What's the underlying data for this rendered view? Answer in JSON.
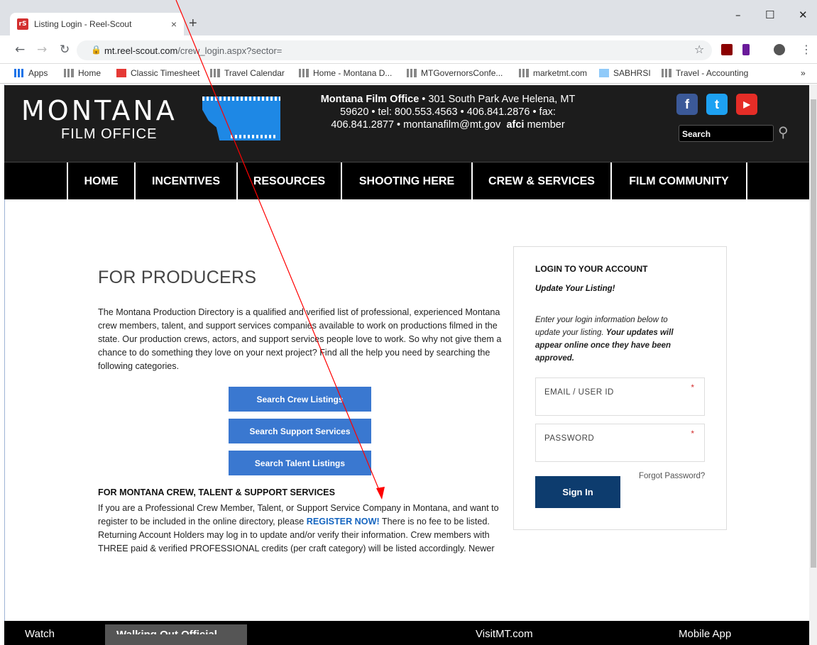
{
  "browser": {
    "tab_title": "Listing Login - Reel-Scout",
    "favicon_text": "rS",
    "tab_close": "×",
    "new_tab": "+",
    "url_domain": "mt.reel-scout.com",
    "url_path": "/crew_login.aspx?sector=",
    "win_min": "–",
    "win_max": "☐",
    "win_close": "✕",
    "bookmarks": [
      "Apps",
      "Home",
      "Classic Timesheet",
      "Travel Calendar",
      "Home - Montana D...",
      "MTGovernorsConfe...",
      "marketmt.com",
      "SABHRSI",
      "Travel - Accounting"
    ],
    "more": "»"
  },
  "header": {
    "logo_main": "MONTANA",
    "logo_sub": "FILM OFFICE",
    "contact_bold": "Montana Film Office",
    "contact_line1": " • 301 South Park Ave Helena, MT",
    "contact_line2": "59620 • tel: 800.553.4563 • 406.841.2876 • fax:",
    "contact_line3": "406.841.2877 • montanafilm@mt.gov",
    "afci": "afci",
    "member": "member",
    "search_placeholder": "Search"
  },
  "nav": [
    "HOME",
    "INCENTIVES",
    "RESOURCES",
    "SHOOTING HERE",
    "CREW & SERVICES",
    "FILM COMMUNITY"
  ],
  "main": {
    "title": "FOR PRODUCERS",
    "intro": "The Montana Production Directory is a qualified and verified list of professional, experienced Montana crew members, talent, and support services companies available to work on productions filmed in the state. Our production crews, actors, and support services people love to work. So why not give them a chance to do something they love on your next project? Find all the help you need by searching the following categories.",
    "buttons": [
      "Search Crew Listings",
      "Search Support Services",
      "Search Talent Listings"
    ],
    "section_title": "FOR MONTANA CREW, TALENT & SUPPORT SERVICES",
    "section_pre": "If you are a Professional Crew Member, Talent, or Support Service Company in Montana, and want to register to be included in the online directory, please ",
    "register": "REGISTER NOW!",
    "section_post": " There is no fee to be listed. Returning Account Holders may log in to update and/or verify their information. Crew members with THREE paid & verified PROFESSIONAL credits (per craft category) will be listed accordingly. Newer crew members, who are continuing to build their resumes, and are accruing these THREE required PROFESSIONAL credits per skill category, will have the opportunity to list their skills under the 'RECRUIT' option in each skill category. Once a new crew member has achieved the THREE required paid & verified PROFESSIONAL credits per each skill category, they will then qualify to be listed under the regular professional skill category as applicable. Please"
  },
  "login": {
    "title": "LOGIN TO YOUR ACCOUNT",
    "subtitle": "Update Your Listing!",
    "info_pre": "Enter your login information below to update your listing. ",
    "info_bold": "Your updates will appear online once they have been approved.",
    "email_label": "EMAIL / USER ID",
    "password_label": "PASSWORD",
    "required_mark": "*",
    "forgot": "Forgot Password?",
    "sign_in": "Sign In"
  },
  "footer": {
    "watch": "Watch",
    "video_caption": "Walking Out Official",
    "visit": "VisitMT.com",
    "mobile": "Mobile App"
  },
  "colors": {
    "accent_blue": "#3a78d0",
    "signin_navy": "#0d3c6e",
    "register_link": "#1565c0",
    "annotation_arrow": "#ff0000"
  }
}
